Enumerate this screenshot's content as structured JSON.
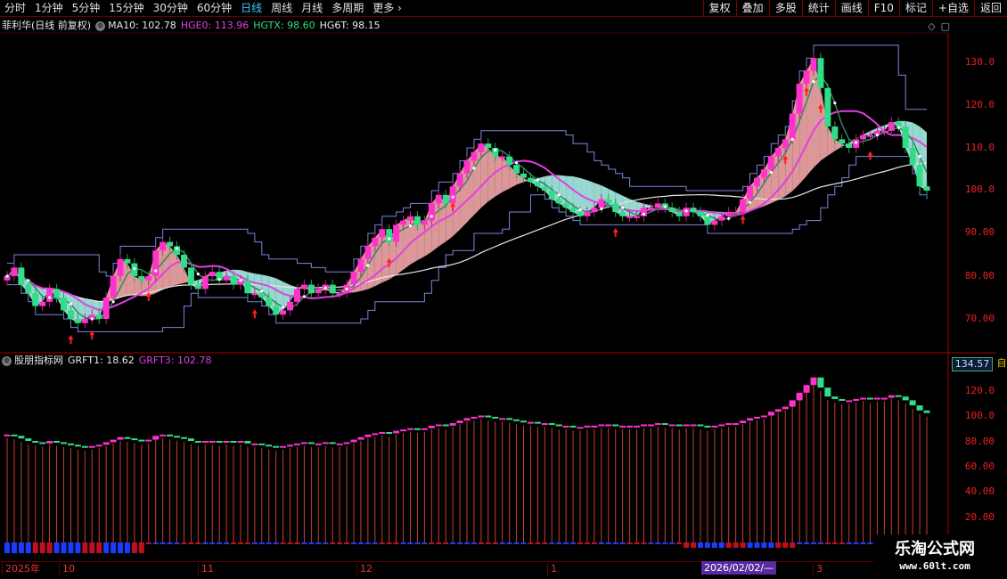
{
  "toolbar": {
    "periods": [
      "分时",
      "1分钟",
      "5分钟",
      "15分钟",
      "30分钟",
      "60分钟",
      "日线",
      "周线",
      "月线",
      "多周期",
      "更多 ›"
    ],
    "active_period": "日线",
    "buttons": [
      "复权",
      "叠加",
      "多股",
      "统计",
      "画线",
      "F10",
      "标记",
      "+自选",
      "返回"
    ]
  },
  "main_legend": {
    "stock": "菲利华(日线 前复权)",
    "ma10": "MA10: 102.78",
    "hge0": "HGE0: 113.96",
    "hgtx": "HGTX: 98.60",
    "hg6t": "HG6T: 98.15"
  },
  "sub_legend": {
    "name": "股朋指标网",
    "grft1": "GRFT1: 18.62",
    "grft3": "GRFT3: 102.78"
  },
  "price_axis": [
    "130.0",
    "120.0",
    "110.0",
    "100.0",
    "90.00",
    "80.00",
    "70.00"
  ],
  "sub_axis": [
    "120.0",
    "100.0",
    "80.00",
    "60.00",
    "40.00",
    "20.00"
  ],
  "sub_price_box": "134.57",
  "dates": [
    "2025年",
    "10",
    "11",
    "12",
    "1",
    "3"
  ],
  "date_cursor": "2026/02/02/—",
  "watermark": {
    "title": "乐淘公式网",
    "url": "www.60lt.com"
  },
  "colors": {
    "up": "#ff33cc",
    "down": "#33dd88",
    "ma_magenta": "#e040e0",
    "ma_white": "#e8e8e8",
    "channel": "#7a86e0",
    "cloud_up": "#f4a8a8",
    "cloud_down": "#a8f0e8",
    "axis_red": "#e22"
  },
  "chart_data": {
    "type": "candlestick",
    "y_range": [
      65,
      137
    ],
    "closes": [
      80,
      82,
      78,
      76,
      73,
      74,
      77,
      75,
      72,
      70,
      69,
      70,
      71,
      70,
      75,
      80,
      84,
      83,
      80,
      79,
      80,
      86,
      88,
      87,
      85,
      82,
      78,
      77,
      80,
      81,
      79,
      80,
      78,
      79,
      76,
      76,
      75,
      73,
      71,
      72,
      74,
      77,
      78,
      76,
      77,
      78,
      76,
      76,
      78,
      81,
      84,
      87,
      89,
      91,
      88,
      92,
      93,
      94,
      92,
      93,
      97,
      99,
      97,
      101,
      104,
      107,
      109,
      111,
      110,
      108,
      108,
      106,
      104,
      103,
      102,
      101,
      100,
      98,
      97,
      96,
      95,
      94,
      95,
      96,
      98,
      97,
      95,
      94,
      94,
      94,
      96,
      96,
      97,
      96,
      95,
      94,
      96,
      95,
      94,
      92,
      93,
      94,
      95,
      95,
      98,
      101,
      103,
      105,
      108,
      110,
      112,
      118,
      125,
      128,
      131,
      124,
      115,
      112,
      111,
      110,
      112,
      113,
      113,
      114,
      114,
      116,
      115,
      110,
      106,
      101,
      100
    ],
    "sub_values": [
      85,
      84,
      82,
      80,
      79,
      78,
      80,
      79,
      78,
      77,
      76,
      75,
      76,
      77,
      79,
      81,
      83,
      82,
      81,
      80,
      81,
      84,
      85,
      84,
      83,
      82,
      80,
      79,
      80,
      80,
      79,
      80,
      79,
      80,
      78,
      78,
      77,
      76,
      75,
      76,
      77,
      78,
      79,
      78,
      78,
      79,
      78,
      78,
      79,
      81,
      83,
      85,
      86,
      87,
      86,
      88,
      89,
      90,
      89,
      90,
      92,
      93,
      92,
      94,
      96,
      98,
      99,
      100,
      99,
      98,
      98,
      97,
      96,
      95,
      95,
      94,
      94,
      93,
      92,
      92,
      91,
      91,
      92,
      92,
      93,
      93,
      92,
      92,
      92,
      92,
      93,
      93,
      94,
      93,
      93,
      92,
      93,
      93,
      92,
      91,
      92,
      93,
      94,
      94,
      96,
      98,
      99,
      100,
      103,
      105,
      107,
      112,
      118,
      124,
      130,
      122,
      115,
      113,
      112,
      112,
      113,
      114,
      113,
      114,
      114,
      116,
      115,
      112,
      108,
      104,
      102
    ]
  }
}
